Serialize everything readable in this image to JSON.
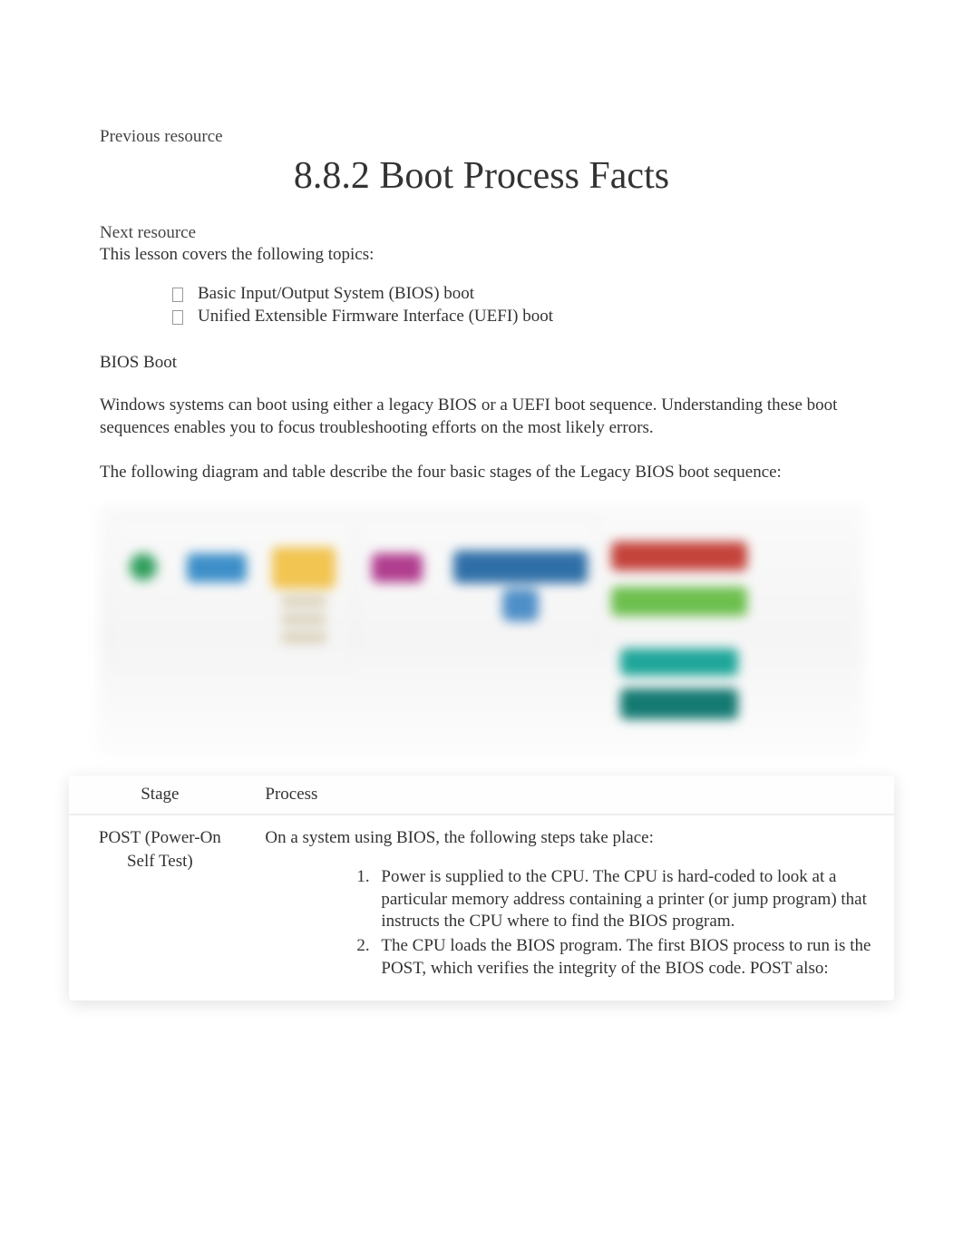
{
  "nav": {
    "previous_label": "Previous resource",
    "next_label": "Next resource"
  },
  "title": "8.8.2 Boot Process Facts",
  "intro": "This lesson covers the following topics:",
  "topics": [
    "Basic Input/Output System (BIOS) boot",
    "Unified Extensible Firmware Interface (UEFI) boot"
  ],
  "section_heading": "BIOS Boot",
  "paragraphs": [
    "Windows systems can boot using either a legacy BIOS or a UEFI boot sequence. Understanding these boot sequences enables you to focus troubleshooting efforts on the most likely errors.",
    "The following diagram and table describe the four basic stages of the Legacy BIOS boot sequence:"
  ],
  "table": {
    "headers": {
      "stage": "Stage",
      "process": "Process"
    },
    "rows": [
      {
        "stage": "POST (Power-On Self Test)",
        "process_intro": "On a system using BIOS, the following steps take place:",
        "steps": [
          "Power is supplied to the CPU. The CPU is hard-coded to look at a particular memory address containing a printer (or jump program) that instructs the CPU where to find the BIOS program.",
          "The CPU loads the BIOS program. The first BIOS process to run is the POST, which verifies the integrity of the BIOS code. POST also:"
        ]
      }
    ]
  }
}
